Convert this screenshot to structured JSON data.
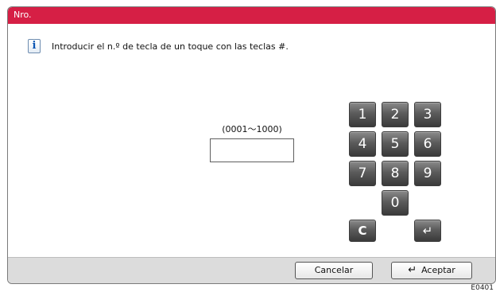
{
  "dialog": {
    "title": "Nro.",
    "icon": "info-icon",
    "icon_glyph": "i",
    "message": "Introducir el n.º de tecla de un toque con las teclas #.",
    "range_label": "(0001～1000)",
    "number_value": ""
  },
  "keypad": {
    "k1": "1",
    "k2": "2",
    "k3": "3",
    "k4": "4",
    "k5": "5",
    "k6": "6",
    "k7": "7",
    "k8": "8",
    "k9": "9",
    "k0": "0",
    "clear": "C",
    "enter": "↵"
  },
  "buttons": {
    "cancel": "Cancelar",
    "accept_icon": "↵",
    "accept": "Aceptar"
  },
  "footer": {
    "code": "E0401"
  },
  "colors": {
    "title_bar": "#d61f45",
    "key_face": "#5b5b5b",
    "status_bar": "#dcdcdc"
  }
}
